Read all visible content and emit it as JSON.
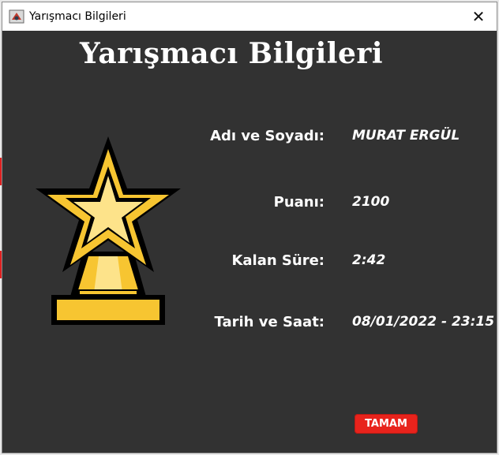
{
  "window": {
    "title": "Yarışmacı Bilgileri",
    "close_symbol": "✕"
  },
  "dialog": {
    "heading": "Yarışmacı Bilgileri",
    "trophy_icon": "star-trophy-icon",
    "fields": [
      {
        "label": "Adı ve Soyadı:",
        "value": "MURAT ERGÜL"
      },
      {
        "label": "Puanı:",
        "value": "2100"
      },
      {
        "label": "Kalan Süre:",
        "value": "2:42"
      },
      {
        "label": "Tarih ve Saat:",
        "value": "08/01/2022 - 23:15"
      }
    ],
    "ok_label": "TAMAM"
  },
  "colors": {
    "background": "#323232",
    "text": "#ffffff",
    "button": "#e8231c",
    "trophy_gold": "#f7c531",
    "trophy_light": "#fde38a",
    "trophy_outline": "#000000"
  }
}
